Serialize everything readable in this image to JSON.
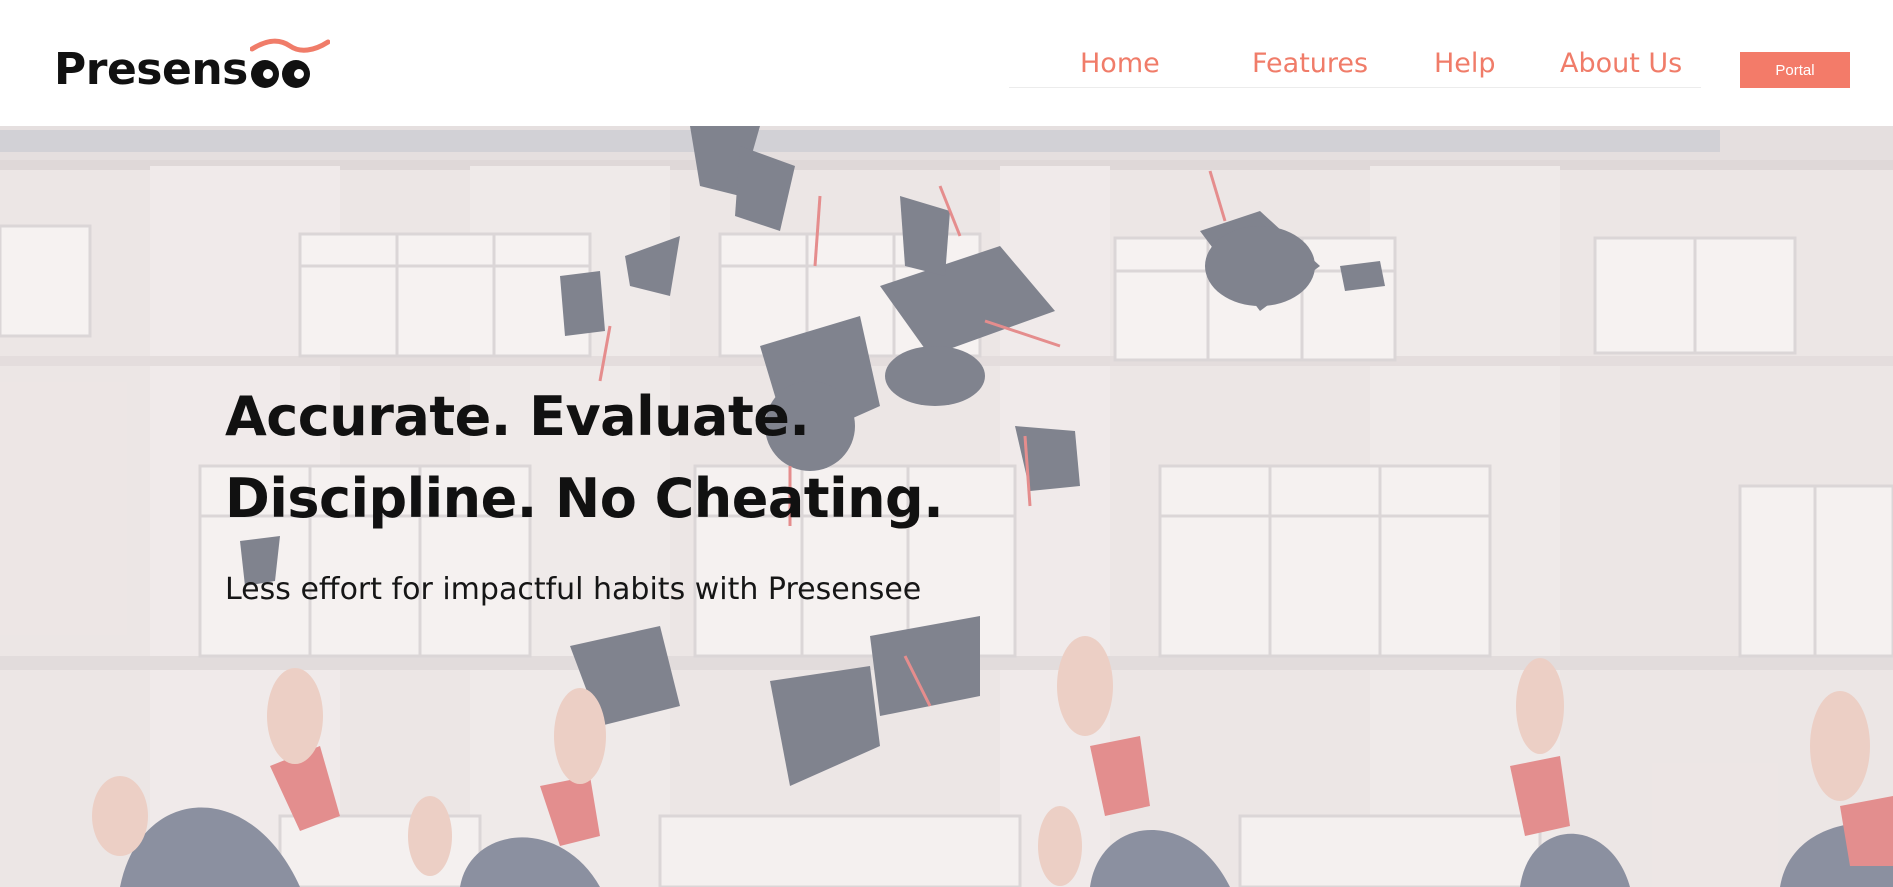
{
  "brand": {
    "name": "Presens",
    "accent_color": "#f07c69",
    "text_color": "#111111"
  },
  "nav": {
    "items": [
      {
        "label": "Home"
      },
      {
        "label": "Features"
      },
      {
        "label": "Help"
      },
      {
        "label": "About Us"
      }
    ],
    "portal_label": "Portal"
  },
  "hero": {
    "headline_line1": "Accurate. Evaluate.",
    "headline_line2": "Discipline. No Cheating.",
    "tagline": "Less effort for impactful habits with Presensee",
    "background_image": "graduates-throwing-caps-photo"
  }
}
